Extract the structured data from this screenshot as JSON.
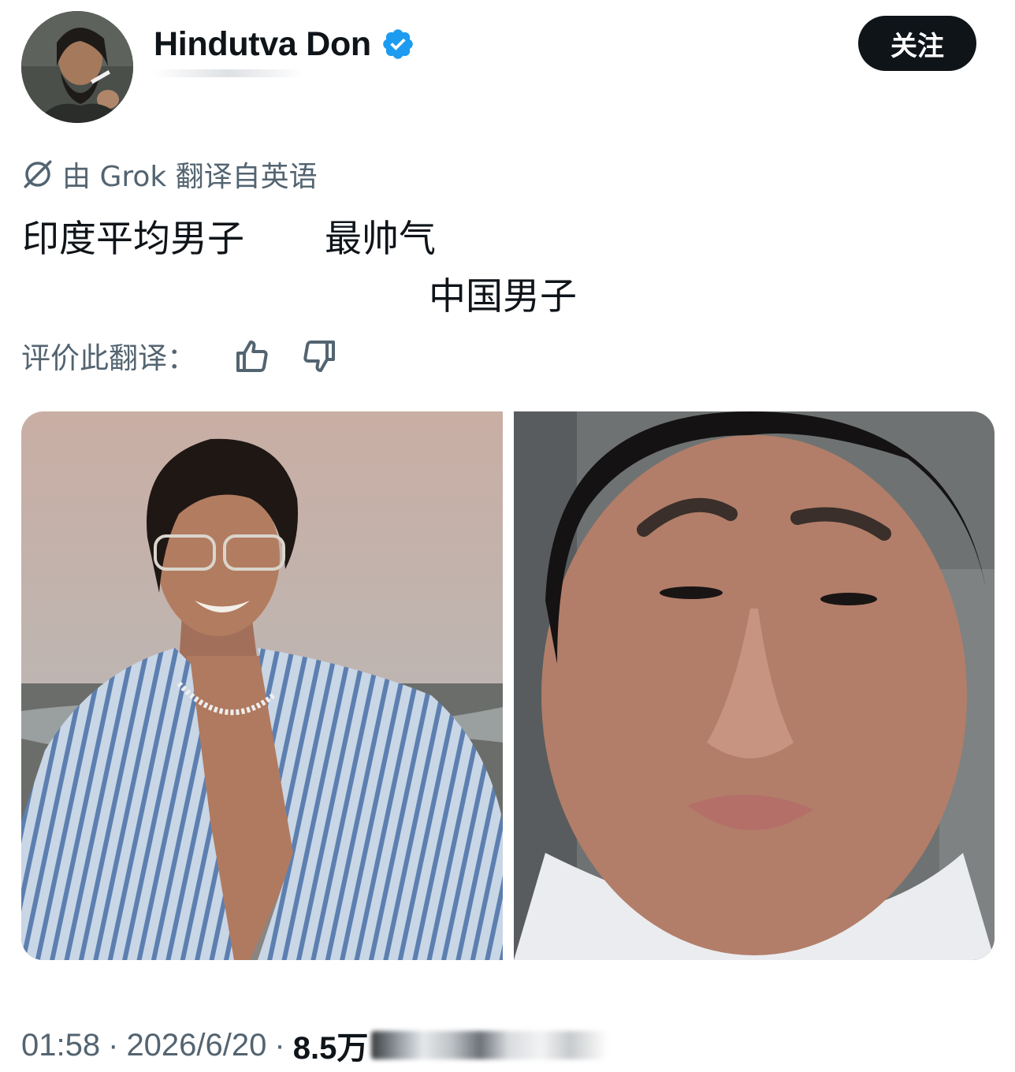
{
  "header": {
    "display_name": "Hindutva Don",
    "verified": true,
    "follow_label": "关注"
  },
  "translation": {
    "notice": "由 Grok 翻译自英语",
    "icon": "translate-off-icon"
  },
  "tweet": {
    "line1_part1": "印度平均男子",
    "line1_part2": "最帅气",
    "line2": "中国男子"
  },
  "rate": {
    "label": "评价此翻译：",
    "thumbs_up_icon": "thumbs-up-icon",
    "thumbs_down_icon": "thumbs-down-icon"
  },
  "media": {
    "photos": [
      {
        "name": "photo-left"
      },
      {
        "name": "photo-right"
      }
    ]
  },
  "meta": {
    "time": "01:58",
    "date": "2026/6/20",
    "views": "8.5万"
  },
  "colors": {
    "text_primary": "#0f1419",
    "text_secondary": "#536471",
    "verified_blue": "#1d9bf0",
    "button_bg": "#0f1419"
  }
}
